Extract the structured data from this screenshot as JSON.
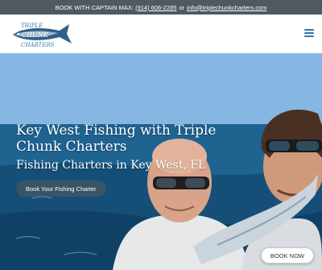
{
  "topbar": {
    "prefix": "BOOK WITH CAPTAIN MAX:",
    "phone": "(914) 606-2285",
    "or": "or",
    "email": "info@triplechunkcharters.com"
  },
  "logo": {
    "line1": "TRIPLE",
    "line2": "CHUNK",
    "line3": "CHARTERS"
  },
  "header": {
    "menu_icon": "hamburger-menu-icon"
  },
  "hero": {
    "title": "Key West Fishing with Triple Chunk Charters",
    "subtitle": "Fishing Charters in Key West, FL",
    "cta_label": "Book Your Fishing Charter"
  },
  "book_now_label": "BOOK NOW",
  "colors": {
    "topbar_bg": "#4f5962",
    "accent_blue": "#2d78b6"
  }
}
